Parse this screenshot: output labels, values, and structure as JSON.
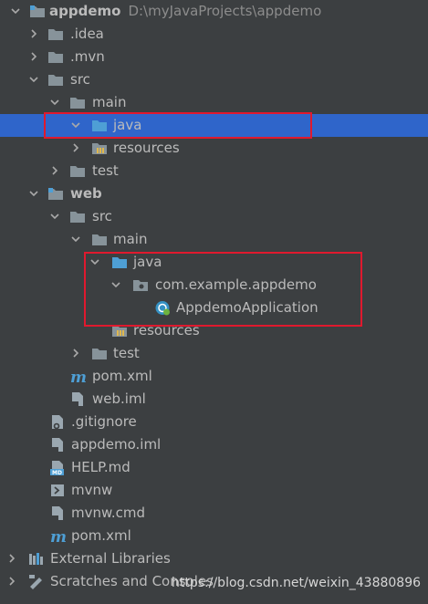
{
  "tree": {
    "project": {
      "name": "appdemo",
      "path": "D:\\myJavaProjects\\appdemo"
    },
    "rows": {
      "idea": ".idea",
      "mvn": ".mvn",
      "src": "src",
      "main": "main",
      "java": "java",
      "resources": "resources",
      "test": "test",
      "web": "web",
      "web_src": "src",
      "web_main": "main",
      "web_java": "java",
      "package": "com.example.appdemo",
      "app_class": "AppdemoApplication",
      "web_resources": "resources",
      "web_test": "test",
      "web_pom": "pom.xml",
      "web_iml": "web.iml",
      "gitignore": ".gitignore",
      "appdemo_iml": "appdemo.iml",
      "help_md": "HELP.md",
      "mvnw": "mvnw",
      "mvnw_cmd": "mvnw.cmd",
      "pom": "pom.xml",
      "external_libraries": "External Libraries",
      "scratches": "Scratches and Consoles"
    }
  },
  "watermark": "https://blog.csdn.net/weixin_43880896",
  "colors": {
    "background": "#3c3f41",
    "selection": "#2f65ca",
    "highlight_box": "#e0192e",
    "folder": "#87939a",
    "source_folder": "#4e9fd5",
    "maven": "#4e9fd5"
  }
}
